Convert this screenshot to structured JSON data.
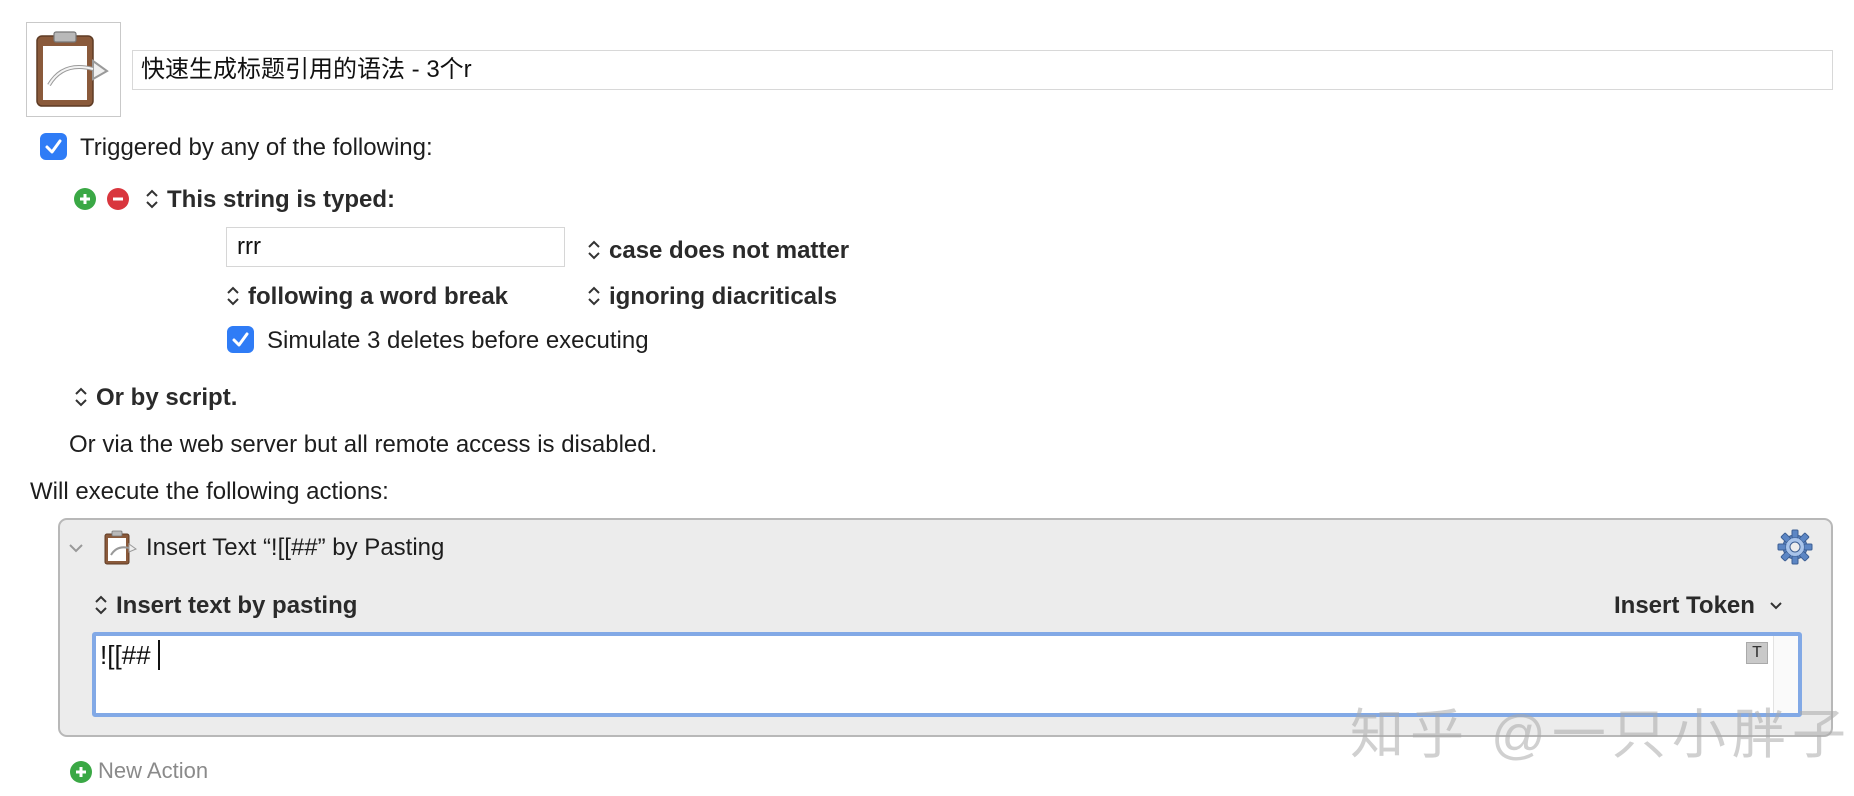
{
  "macro": {
    "name": "快速生成标题引用的语法 - 3个r",
    "icon": "clipboard-icon"
  },
  "triggers": {
    "enabled_label": "Triggered by any of the following:",
    "enabled": true,
    "string_trigger": {
      "label": "This string is typed:",
      "value": "rrr",
      "case_option": "case does not matter",
      "word_break_option": "following a word break",
      "diacritics_option": "ignoring diacriticals",
      "simulate_deletes_label": "Simulate 3 deletes before executing",
      "simulate_deletes": true
    },
    "script_label": "Or by script.",
    "web_server_note": "Or via the web server but all remote access is disabled."
  },
  "actions": {
    "header": "Will execute the following actions:",
    "items": [
      {
        "title": "Insert Text “![[##” by Pasting",
        "mode": "Insert text by pasting",
        "insert_token_label": "Insert Token",
        "text": "![[##",
        "token_badge": "T"
      }
    ],
    "new_action_label": "New Action"
  },
  "watermark": "知乎 @一只小胖子",
  "colors": {
    "accent": "#2f7cf6",
    "focus_ring": "#82a9e6",
    "add_green": "#3aa845",
    "remove_red": "#d9363e"
  }
}
